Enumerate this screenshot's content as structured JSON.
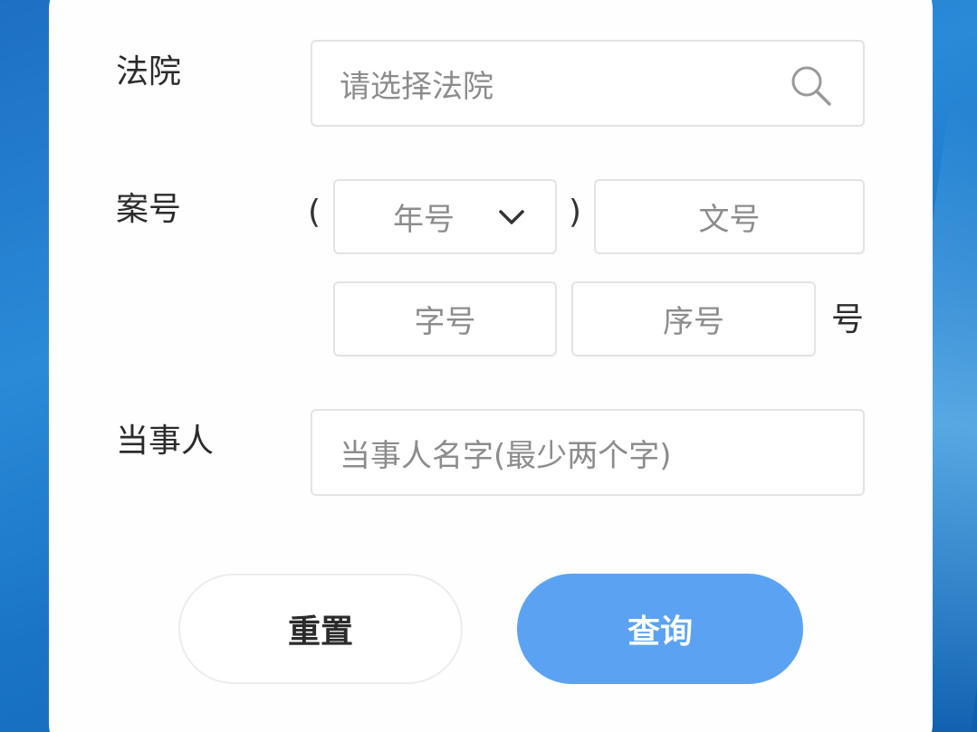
{
  "form": {
    "court": {
      "label": "法院",
      "placeholder": "请选择法院",
      "icon": "search-icon"
    },
    "case_number": {
      "label": "案号",
      "open_paren": "(",
      "close_paren": ")",
      "year": {
        "placeholder": "年号",
        "icon": "chevron-down-icon"
      },
      "doc_no": {
        "placeholder": "文号"
      },
      "char_no": {
        "placeholder": "字号"
      },
      "seq_no": {
        "placeholder": "序号"
      },
      "suffix": "号"
    },
    "party": {
      "label": "当事人",
      "placeholder": "当事人名字(最少两个字)"
    }
  },
  "actions": {
    "reset_label": "重置",
    "query_label": "查询"
  },
  "colors": {
    "accent": "#5ba3f2",
    "background": "#1d6fc4",
    "card": "#fefefe",
    "border": "#e3e3e3",
    "placeholder": "#8c8c8c"
  }
}
